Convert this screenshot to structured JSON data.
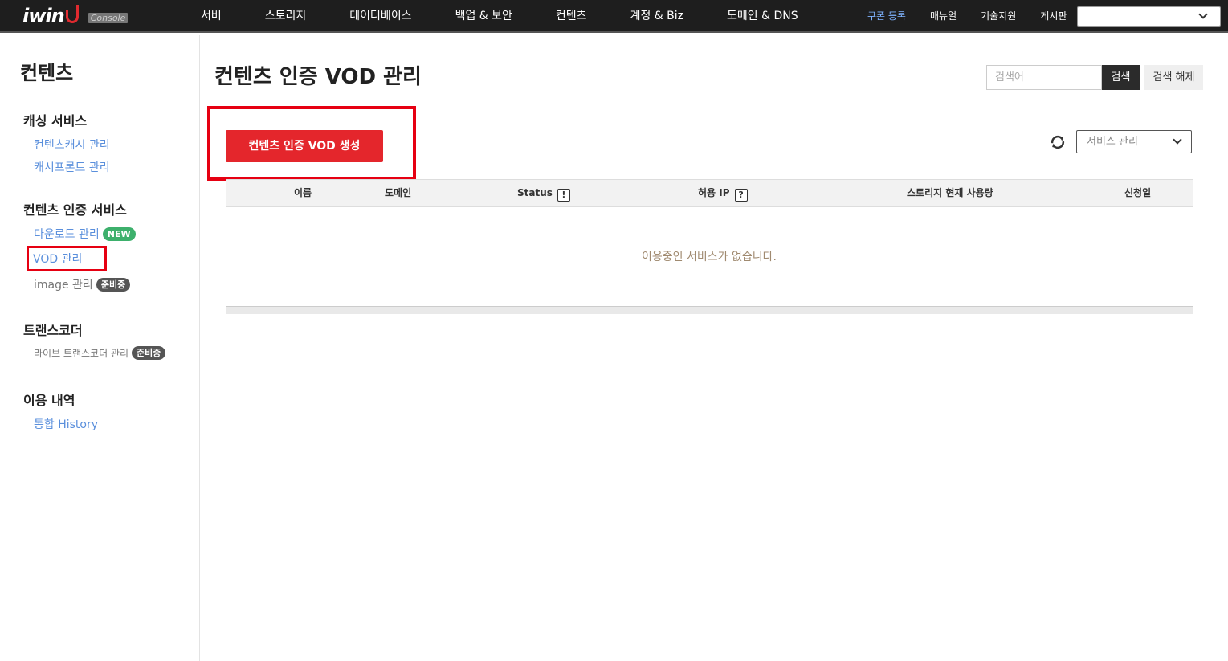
{
  "header": {
    "logo": "iwin",
    "console_badge": "Console",
    "menu": [
      "서버",
      "스토리지",
      "데이터베이스",
      "백업 & 보안",
      "컨텐츠",
      "계정 & Biz",
      "도메인 & DNS"
    ],
    "util": [
      "쿠폰 등록",
      "매뉴얼",
      "기술지원",
      "게시판"
    ],
    "select_value": ""
  },
  "sidebar": {
    "title": "컨텐츠",
    "sections": [
      {
        "heading": "캐싱 서비스",
        "links": [
          "컨텐츠캐시 관리",
          "캐시프론트 관리"
        ]
      },
      {
        "heading": "컨텐츠 인증 서비스",
        "links": [
          "다운로드 관리",
          "VOD 관리",
          "image 관리"
        ],
        "badges": [
          "NEW",
          "준비중"
        ]
      },
      {
        "heading": "트랜스코더",
        "links": [
          "라이브 트랜스코더 관리"
        ],
        "badges": [
          "준비중"
        ]
      },
      {
        "heading": "이용 내역",
        "links": [
          "통합 History"
        ]
      }
    ]
  },
  "main": {
    "page_title": "컨텐츠 인증 VOD 관리",
    "search": {
      "placeholder": "검색어",
      "button": "검색",
      "reset": "검색 해제"
    },
    "create_button": "컨텐츠 인증 VOD 생성",
    "service_select": "서비스 관리",
    "table": {
      "columns": [
        "이름",
        "도메인",
        "Status",
        "허용 IP",
        "스토리지 현재 사용량",
        "신청일"
      ],
      "status_help": "!",
      "ip_help": "?",
      "empty_message": "이용중인 서비스가 없습니다."
    }
  },
  "colors": {
    "accent_red": "#e4262c",
    "link_blue": "#5a8fdc",
    "highlight_box": "#e60012"
  }
}
